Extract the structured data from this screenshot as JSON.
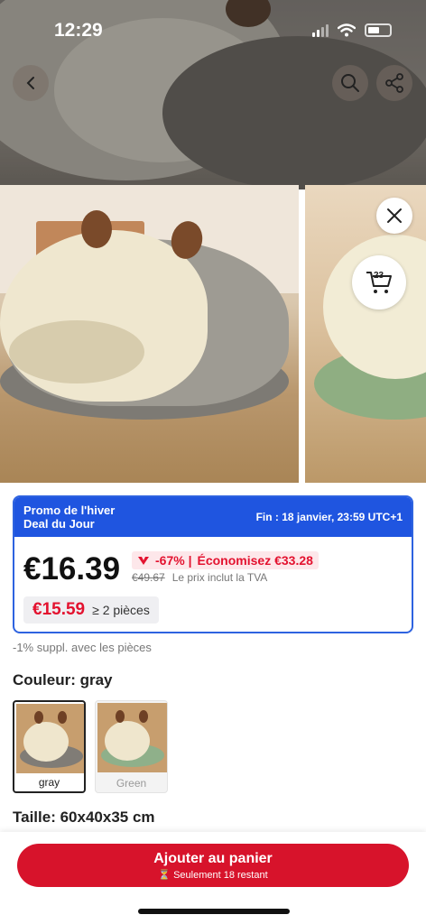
{
  "status_bar": {
    "time": "12:29"
  },
  "header": {
    "back_icon": "chevron-left-icon",
    "search_icon": "search-icon",
    "share_icon": "share-icon"
  },
  "gallery": {
    "close_icon": "close-icon",
    "cart_icon": "cart-icon",
    "cart_count": "23"
  },
  "promo": {
    "title_line1": "Promo de l'hiver",
    "title_line2": "Deal du Jour",
    "ends": "Fin : 18 janvier, 23:59 UTC+1",
    "price": "€16.39",
    "discount": "-67% |",
    "savings": "Économisez €33.28",
    "original_price": "€49.67",
    "vat_note": "Le prix inclut la TVA",
    "bulk_price": "€15.59",
    "bulk_qty": "≥ 2 pièces",
    "accent_color": "#1f55e0",
    "sale_color": "#e3122f"
  },
  "extra_discount": "-1% suppl. avec les pièces",
  "color": {
    "label": "Couleur: gray",
    "options": [
      {
        "label": "gray",
        "selected": true
      },
      {
        "label": "Green",
        "selected": false
      }
    ]
  },
  "size": {
    "label": "Taille: 60x40x35 cm"
  },
  "bottom_bar": {
    "add_to_cart": "Ajouter au panier",
    "stock_note": "⏳ Seulement 18 restant",
    "button_color": "#d7132b"
  }
}
